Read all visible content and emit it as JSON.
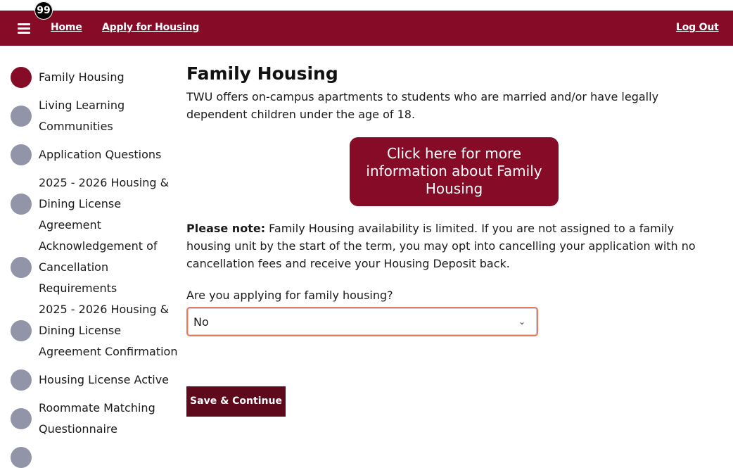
{
  "header": {
    "badge_count": "99",
    "home_label": "Home",
    "apply_label": "Apply for Housing",
    "logout_label": "Log Out",
    "brand_color": "#850b26"
  },
  "sidebar": {
    "steps": [
      {
        "label": "Family Housing",
        "status": "active"
      },
      {
        "label": "Living Learning Communities",
        "status": "pending"
      },
      {
        "label": "Application Questions",
        "status": "pending"
      },
      {
        "label": "2025 - 2026 Housing & Dining License Agreement",
        "status": "pending"
      },
      {
        "label": "Acknowledgement of Cancellation Requirements",
        "status": "pending"
      },
      {
        "label": "2025 - 2026 Housing & Dining License Agreement Confirmation",
        "status": "pending"
      },
      {
        "label": "Housing License Active",
        "status": "pending"
      },
      {
        "label": "Roommate Matching Questionnaire",
        "status": "pending"
      }
    ]
  },
  "main": {
    "title": "Family Housing",
    "intro": "TWU offers on-campus apartments to students who are married and/or have legally dependent children under the age of 18.",
    "cta_label": "Click here for more information about Family Housing",
    "note_bold": "Please note:",
    "note_text": " Family Housing availability is limited. If you are not assigned to a family housing unit by the start of the term, you may opt into cancelling your application with no cancellation fees and receive your Housing Deposit back.",
    "question": "Are you applying for family housing?",
    "select_value": "No",
    "save_label": "Save & Continue"
  }
}
